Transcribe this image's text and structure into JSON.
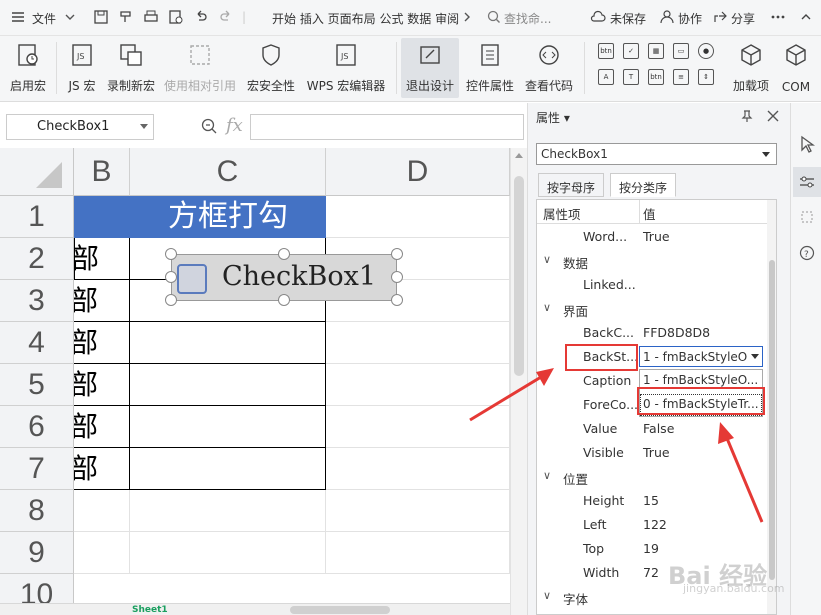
{
  "menubar": {
    "file": "文件",
    "tabs_text": "开始 插入 页面布局 公式 数据 审阅",
    "search_placeholder": "查找命...",
    "unsaved": "未保存",
    "collab": "协作",
    "share": "分享"
  },
  "ribbon": {
    "enable_macro": "启用宏",
    "js_macro": "JS 宏",
    "record_macro": "录制新宏",
    "relative_ref": "使用相对引用",
    "macro_security": "宏安全性",
    "wps_editor": "WPS 宏编辑器",
    "exit_design": "退出设计",
    "control_props": "控件属性",
    "view_code": "查看代码",
    "small_btn1": "btn",
    "small_btn2": "btn",
    "addins": "加载项",
    "com": "COM"
  },
  "formula_bar": {
    "name_box": "CheckBox1",
    "fx": "fx"
  },
  "sheet": {
    "columns": [
      "B",
      "C",
      "D"
    ],
    "rows": [
      "1",
      "2",
      "3",
      "4",
      "5",
      "6",
      "7",
      "8",
      "9",
      "10"
    ],
    "header_cell": "方框打勾",
    "b_cells": [
      "部",
      "部",
      "部",
      "部",
      "部",
      "部"
    ],
    "tab_label": "Sheet1"
  },
  "checkbox": {
    "caption": "CheckBox1"
  },
  "properties": {
    "title": "属性",
    "object": "CheckBox1",
    "tab_alpha": "按字母序",
    "tab_category": "按分类序",
    "col_name": "属性项",
    "col_value": "值",
    "rows": [
      {
        "name": "Word...",
        "value": "True"
      },
      {
        "cat": "数据"
      },
      {
        "name": "Linked...",
        "value": ""
      },
      {
        "cat": "界面"
      },
      {
        "name": "BackC...",
        "value": "FFD8D8D8"
      },
      {
        "name": "BackSt...",
        "value": "1 - fmBackStyleO"
      },
      {
        "name": "Caption",
        "value": "1 - fmBackStyleO..."
      },
      {
        "name": "ForeCo...",
        "value": "0 - fmBackStyleTr..."
      },
      {
        "name": "Value",
        "value": "False"
      },
      {
        "name": "Visible",
        "value": "True"
      },
      {
        "cat": "位置"
      },
      {
        "name": "Height",
        "value": "15"
      },
      {
        "name": "Left",
        "value": "122"
      },
      {
        "name": "Top",
        "value": "19"
      },
      {
        "name": "Width",
        "value": "72"
      },
      {
        "cat": "字体"
      }
    ]
  },
  "watermark": {
    "line1": "Bai 经验",
    "line2": "jingyan.baidu.com"
  },
  "colors": {
    "accent": "#4472c4",
    "annotation": "#e53935"
  }
}
